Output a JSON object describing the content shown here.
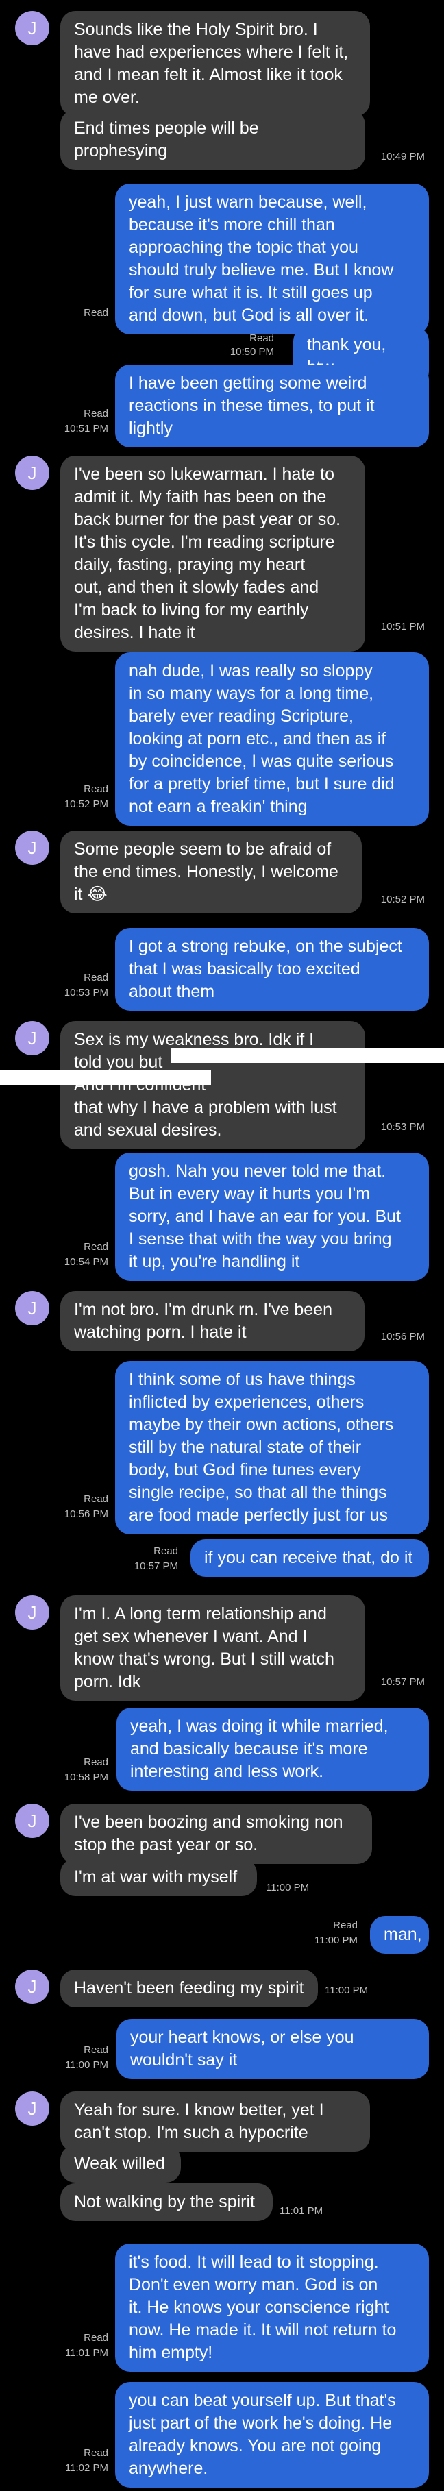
{
  "colors": {
    "background": "#000000",
    "incoming": "#3c3c3c",
    "outgoing": "#2b67d6",
    "avatar": "#a89ae6"
  },
  "avatar_letter": "J",
  "read_label": "Read",
  "messages": [
    {
      "text": "Sounds like the Holy Spirit bro. I\nhave had experiences where I felt it,\nand I mean felt it. Almost like it took\nme over."
    },
    {
      "text": "End times people will be\nprophesying",
      "time": "10:49 PM"
    },
    {
      "text": "yeah, I just warn because, well,\nbecause it's more chill than\napproaching the topic that you\nshould truly believe me. But I know\nfor sure what it is. It still goes up\nand down, but God is all over it."
    },
    {
      "text": "thank you, btw.",
      "time": "10:50 PM"
    },
    {
      "text": "I have been getting some weird\nreactions in these times, to put it\nlightly",
      "time": "10:51 PM"
    },
    {
      "text": "I've been so lukewarman. I hate to\nadmit it. My faith has been on the\nback burner for the past year or so.\nIt's this cycle. I'm reading scripture\ndaily, fasting, praying my heart\nout, and then it slowly fades and\nI'm back to living for my earthly\ndesires. I hate it",
      "time": "10:51 PM"
    },
    {
      "text": "nah dude, I was really so sloppy\nin so many ways for a long time,\nbarely ever reading Scripture,\nlooking at porn etc., and then as if\nby coincidence, I was quite serious\nfor a pretty brief time, but I sure did\nnot earn a freakin' thing",
      "time": "10:52 PM"
    },
    {
      "text": "Some people seem to be afraid of\nthe end times. Honestly, I welcome\nit 😂",
      "time": "10:52 PM"
    },
    {
      "text": "I got a strong rebuke, on the subject\nthat I was basically too excited\nabout them",
      "time": "10:53 PM"
    },
    {
      "text": "Sex is my weakness bro. Idk if I\ntold you but\n                                    And I'm confident\nthat why I have a problem with lust\nand sexual desires.",
      "time": "10:53 PM"
    },
    {
      "text": "gosh. Nah you never told me that.\nBut in every way it hurts you I'm\nsorry, and I have an ear for you. But\nI sense that with the way you bring\nit up, you're handling it",
      "time": "10:54 PM"
    },
    {
      "text": "I'm not bro. I'm drunk rn. I've been\nwatching porn. I hate it",
      "time": "10:56 PM"
    },
    {
      "text": "I think some of us have things\ninflicted by experiences, others\nmaybe by their own actions, others\nstill by the natural state of their\nbody, but God fine tunes every\nsingle recipe, so that all the things\nare food made perfectly just for us",
      "time": "10:56 PM"
    },
    {
      "text": "if you can receive that, do it",
      "time": "10:57 PM"
    },
    {
      "text": "I'm I. A long term relationship and\nget sex whenever I want. And I\nknow that's wrong. But I still watch\nporn. Idk",
      "time": "10:57 PM"
    },
    {
      "text": "yeah, I was doing it while married,\nand basically because it's more\ninteresting and less work.",
      "time": "10:58 PM"
    },
    {
      "text": "I've been boozing and smoking non\nstop the past year or so."
    },
    {
      "text": "I'm at war with myself",
      "time": "11:00 PM"
    },
    {
      "text": "man,",
      "time": "11:00 PM"
    },
    {
      "text": "Haven't been feeding my spirit",
      "time": "11:00 PM"
    },
    {
      "text": "your heart knows, or else you\nwouldn't say it",
      "time": "11:00 PM"
    },
    {
      "text": "Yeah for sure. I know better, yet I\ncan't stop. I'm such a hypocrite"
    },
    {
      "text": "Weak willed"
    },
    {
      "text": "Not walking by the spirit",
      "time": "11:01 PM"
    },
    {
      "text": "it's food. It will lead to it stopping.\nDon't even worry man. God is on\nit. He knows your conscience right\nnow. He made it. It will not return to\nhim empty!",
      "time": "11:01 PM"
    },
    {
      "text": "you can beat yourself up. But that's\njust part of the work he's doing. He\nalready knows. You are not going\nanywhere.",
      "time": "11:02 PM"
    }
  ]
}
